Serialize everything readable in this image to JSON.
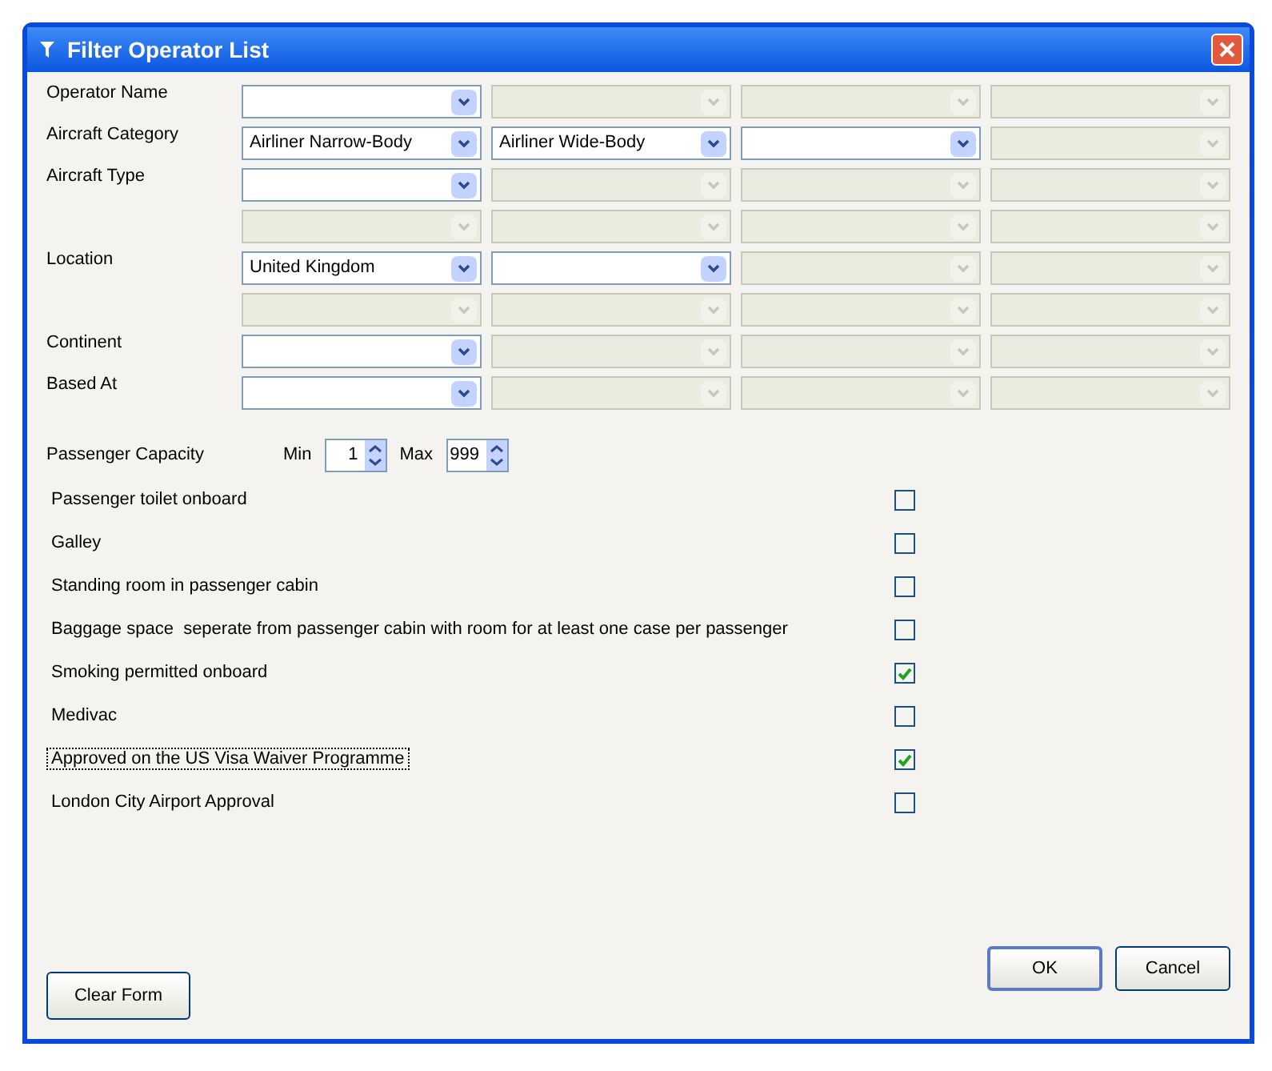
{
  "window": {
    "title": "Filter Operator List"
  },
  "filter_rows": [
    {
      "label": "Operator Name",
      "dropdowns": [
        {
          "disabled": false
        },
        {
          "disabled": true
        },
        {
          "disabled": true
        },
        {
          "disabled": true
        }
      ]
    },
    {
      "label": "Aircraft Category",
      "dropdowns": [
        {
          "value": "Airliner Narrow-Body",
          "disabled": false
        },
        {
          "value": "Airliner Wide-Body",
          "disabled": false
        },
        {
          "disabled": false
        },
        {
          "disabled": true
        }
      ]
    },
    {
      "label": "Aircraft Type",
      "dropdowns": [
        {
          "disabled": false
        },
        {
          "disabled": true
        },
        {
          "disabled": true
        },
        {
          "disabled": true
        }
      ]
    },
    {
      "dropdowns": [
        {
          "disabled": true
        },
        {
          "disabled": true
        },
        {
          "disabled": true
        },
        {
          "disabled": true
        }
      ]
    },
    {
      "label": "Location",
      "dropdowns": [
        {
          "value": "United Kingdom",
          "disabled": false
        },
        {
          "disabled": false
        },
        {
          "disabled": true
        },
        {
          "disabled": true
        }
      ]
    },
    {
      "dropdowns": [
        {
          "disabled": true
        },
        {
          "disabled": true
        },
        {
          "disabled": true
        },
        {
          "disabled": true
        }
      ]
    },
    {
      "label": "Continent",
      "dropdowns": [
        {
          "disabled": false
        },
        {
          "disabled": true
        },
        {
          "disabled": true
        },
        {
          "disabled": true
        }
      ]
    },
    {
      "label": "Based At",
      "dropdowns": [
        {
          "disabled": false
        },
        {
          "disabled": true
        },
        {
          "disabled": true
        },
        {
          "disabled": true
        }
      ]
    }
  ],
  "passenger_capacity": {
    "label": "Passenger Capacity",
    "min_label": "Min",
    "min_value": "1",
    "max_label": "Max",
    "max_value": "999"
  },
  "options": [
    {
      "label": "Passenger toilet onboard",
      "checked": false,
      "focused": false
    },
    {
      "label": "Galley",
      "checked": false,
      "focused": false
    },
    {
      "label": "Standing room in passenger cabin",
      "checked": false,
      "focused": false
    },
    {
      "label": "Baggage space  seperate from passenger cabin with room for at least one case per passenger",
      "checked": false,
      "focused": false
    },
    {
      "label": "Smoking permitted onboard",
      "checked": true,
      "focused": false
    },
    {
      "label": "Medivac",
      "checked": false,
      "focused": false
    },
    {
      "label": "Approved on the US Visa Waiver Programme",
      "checked": true,
      "focused": true
    },
    {
      "label": "London City Airport Approval",
      "checked": false,
      "focused": false
    }
  ],
  "buttons": {
    "clear": "Clear Form",
    "ok": "OK",
    "cancel": "Cancel"
  }
}
